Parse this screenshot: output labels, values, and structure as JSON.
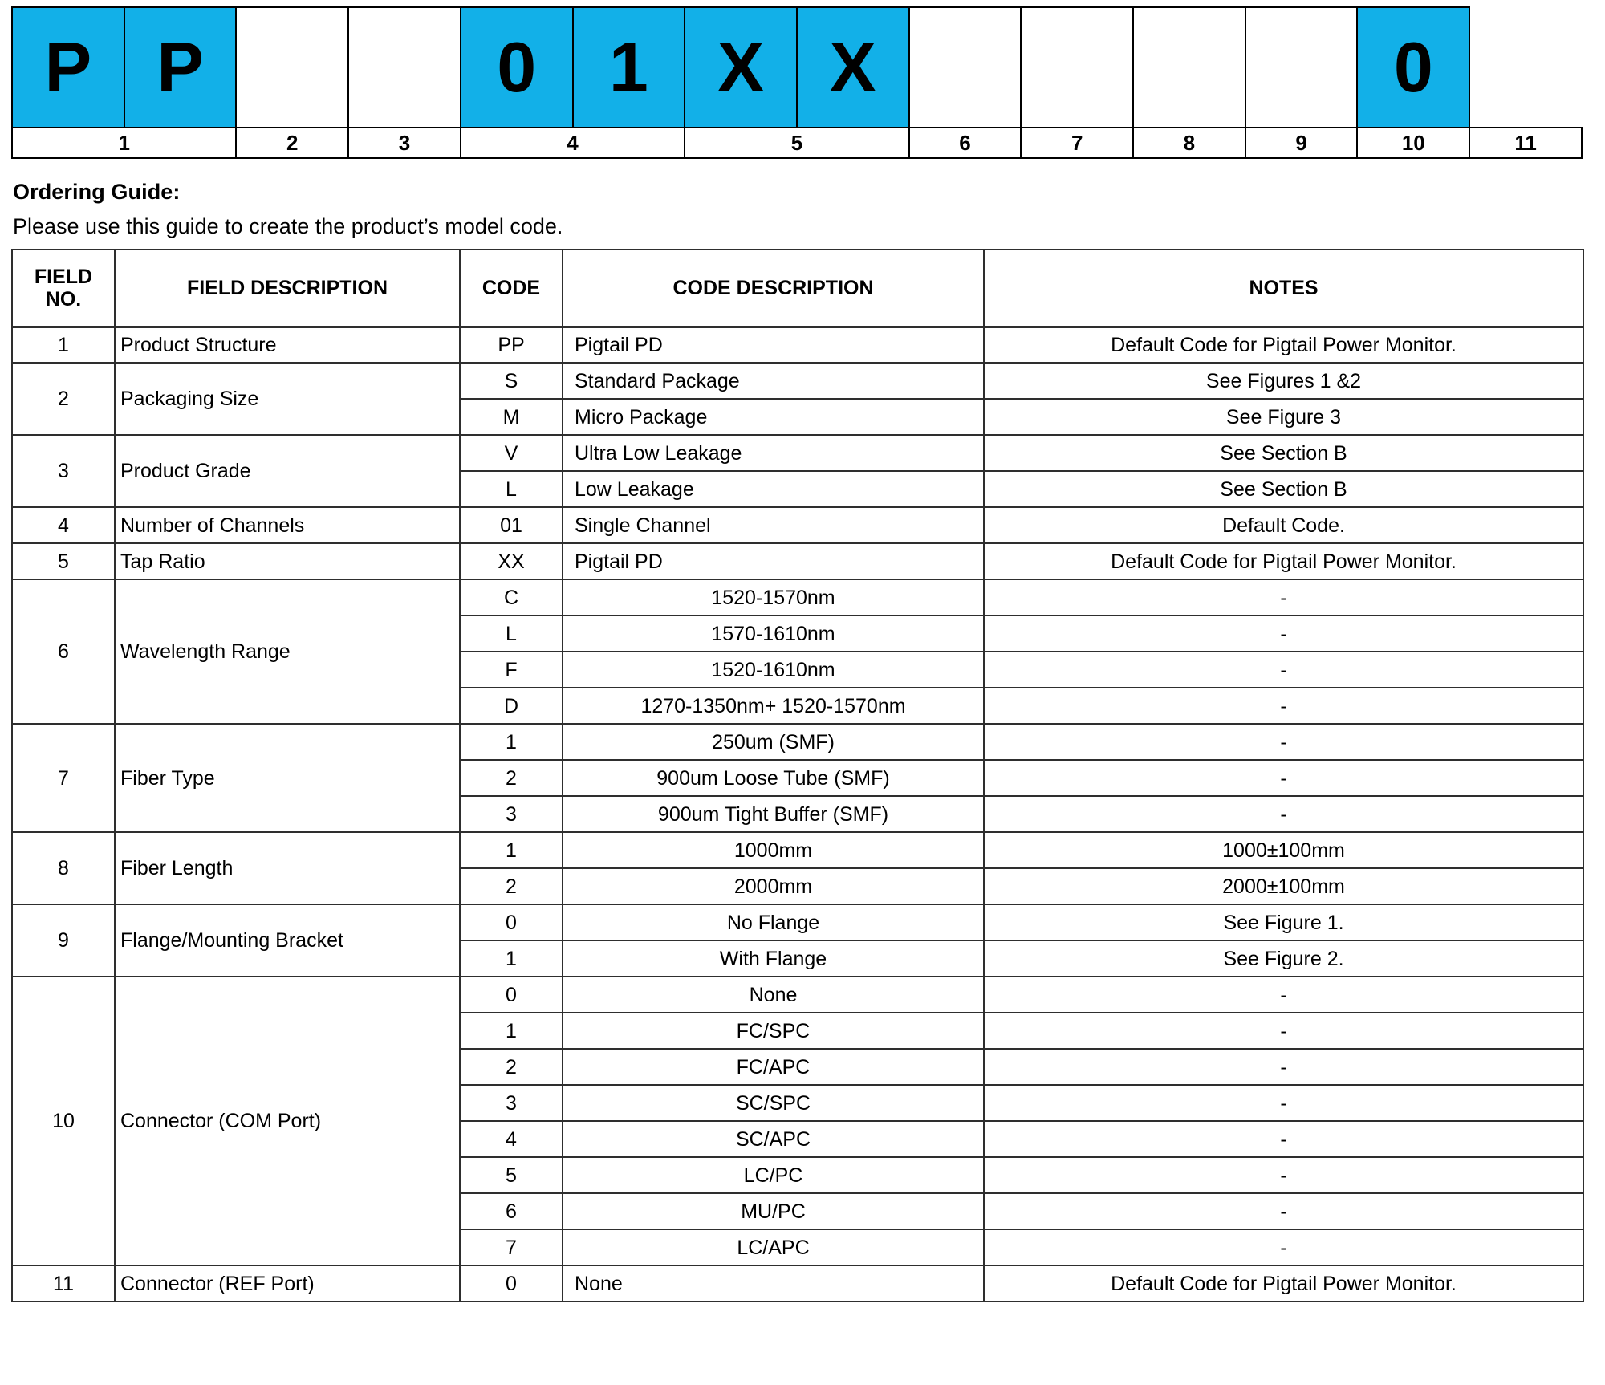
{
  "code_table": {
    "cells": [
      {
        "text": "P",
        "highlight": true
      },
      {
        "text": "P",
        "highlight": true
      },
      {
        "text": "",
        "highlight": false
      },
      {
        "text": "",
        "highlight": false
      },
      {
        "text": "0",
        "highlight": true
      },
      {
        "text": "1",
        "highlight": true
      },
      {
        "text": "X",
        "highlight": true
      },
      {
        "text": "X",
        "highlight": true
      },
      {
        "text": "",
        "highlight": false
      },
      {
        "text": "",
        "highlight": false
      },
      {
        "text": "",
        "highlight": false
      },
      {
        "text": "",
        "highlight": false
      },
      {
        "text": "0",
        "highlight": true
      }
    ],
    "position_labels": [
      {
        "label": "1",
        "span": 2
      },
      {
        "label": "2",
        "span": 1
      },
      {
        "label": "3",
        "span": 1
      },
      {
        "label": "4",
        "span": 2
      },
      {
        "label": "5",
        "span": 2
      },
      {
        "label": "6",
        "span": 1
      },
      {
        "label": "7",
        "span": 1
      },
      {
        "label": "8",
        "span": 1
      },
      {
        "label": "9",
        "span": 1
      },
      {
        "label": "10",
        "span": 1
      },
      {
        "label": "11",
        "span": 1
      }
    ],
    "highlight_color": "#12B0E8"
  },
  "ordering_guide": {
    "title": "Ordering Guide:",
    "subtitle": "Please use this guide to create the product’s model code."
  },
  "table": {
    "headers": {
      "field_no_line1": "FIELD",
      "field_no_line2": "NO.",
      "field_description": "FIELD DESCRIPTION",
      "code": "CODE",
      "code_description": "CODE DESCRIPTION",
      "notes": "NOTES"
    },
    "groups": [
      {
        "field_no": "1",
        "field_description": "Product Structure",
        "desc_align": "left",
        "rows": [
          {
            "code": "PP",
            "code_description": "Pigtail PD",
            "notes": "Default Code for Pigtail Power Monitor."
          }
        ]
      },
      {
        "field_no": "2",
        "field_description": "Packaging Size",
        "desc_align": "left",
        "rows": [
          {
            "code": "S",
            "code_description": "Standard Package",
            "notes": "See Figures 1 &2"
          },
          {
            "code": "M",
            "code_description": "Micro Package",
            "notes": "See Figure 3"
          }
        ]
      },
      {
        "field_no": "3",
        "field_description": "Product Grade",
        "desc_align": "left",
        "rows": [
          {
            "code": "V",
            "code_description": "Ultra Low Leakage",
            "notes": "See Section B"
          },
          {
            "code": "L",
            "code_description": "Low Leakage",
            "notes": "See Section B"
          }
        ]
      },
      {
        "field_no": "4",
        "field_description": "Number of Channels",
        "desc_align": "left",
        "rows": [
          {
            "code": "01",
            "code_description": "Single Channel",
            "notes": "Default Code."
          }
        ]
      },
      {
        "field_no": "5",
        "field_description": "Tap Ratio",
        "desc_align": "left",
        "rows": [
          {
            "code": "XX",
            "code_description": "Pigtail PD",
            "notes": "Default Code for Pigtail Power Monitor."
          }
        ]
      },
      {
        "field_no": "6",
        "field_description": "Wavelength Range",
        "desc_align": "center-text",
        "rows": [
          {
            "code": "C",
            "code_description": "1520-1570nm",
            "notes": "-"
          },
          {
            "code": "L",
            "code_description": "1570-1610nm",
            "notes": "-"
          },
          {
            "code": "F",
            "code_description": "1520-1610nm",
            "notes": "-"
          },
          {
            "code": "D",
            "code_description": "1270-1350nm+ 1520-1570nm",
            "notes": "-"
          }
        ]
      },
      {
        "field_no": "7",
        "field_description": "Fiber Type",
        "desc_align": "center-text",
        "rows": [
          {
            "code": "1",
            "code_description": "250um (SMF)",
            "notes": "-"
          },
          {
            "code": "2",
            "code_description": "900um Loose Tube (SMF)",
            "notes": "-"
          },
          {
            "code": "3",
            "code_description": "900um Tight Buffer (SMF)",
            "notes": "-"
          }
        ]
      },
      {
        "field_no": "8",
        "field_description": "Fiber Length",
        "desc_align": "center-text",
        "rows": [
          {
            "code": "1",
            "code_description": "1000mm",
            "notes": "1000±100mm"
          },
          {
            "code": "2",
            "code_description": "2000mm",
            "notes": "2000±100mm"
          }
        ]
      },
      {
        "field_no": "9",
        "field_description": "Flange/Mounting Bracket",
        "desc_align": "center-text",
        "rows": [
          {
            "code": "0",
            "code_description": "No Flange",
            "notes": "See Figure 1."
          },
          {
            "code": "1",
            "code_description": "With Flange",
            "notes": "See Figure 2."
          }
        ]
      },
      {
        "field_no": "10",
        "field_description": "Connector (COM Port)",
        "desc_align": "center-text",
        "rows": [
          {
            "code": "0",
            "code_description": "None",
            "notes": "-"
          },
          {
            "code": "1",
            "code_description": "FC/SPC",
            "notes": "-"
          },
          {
            "code": "2",
            "code_description": "FC/APC",
            "notes": "-"
          },
          {
            "code": "3",
            "code_description": "SC/SPC",
            "notes": "-"
          },
          {
            "code": "4",
            "code_description": "SC/APC",
            "notes": "-"
          },
          {
            "code": "5",
            "code_description": "LC/PC",
            "notes": "-"
          },
          {
            "code": "6",
            "code_description": "MU/PC",
            "notes": "-"
          },
          {
            "code": "7",
            "code_description": "LC/APC",
            "notes": "-"
          }
        ]
      },
      {
        "field_no": "11",
        "field_description": "Connector (REF Port)",
        "desc_align": "left",
        "rows": [
          {
            "code": "0",
            "code_description": "None",
            "notes": "Default Code for Pigtail Power Monitor."
          }
        ]
      }
    ]
  }
}
